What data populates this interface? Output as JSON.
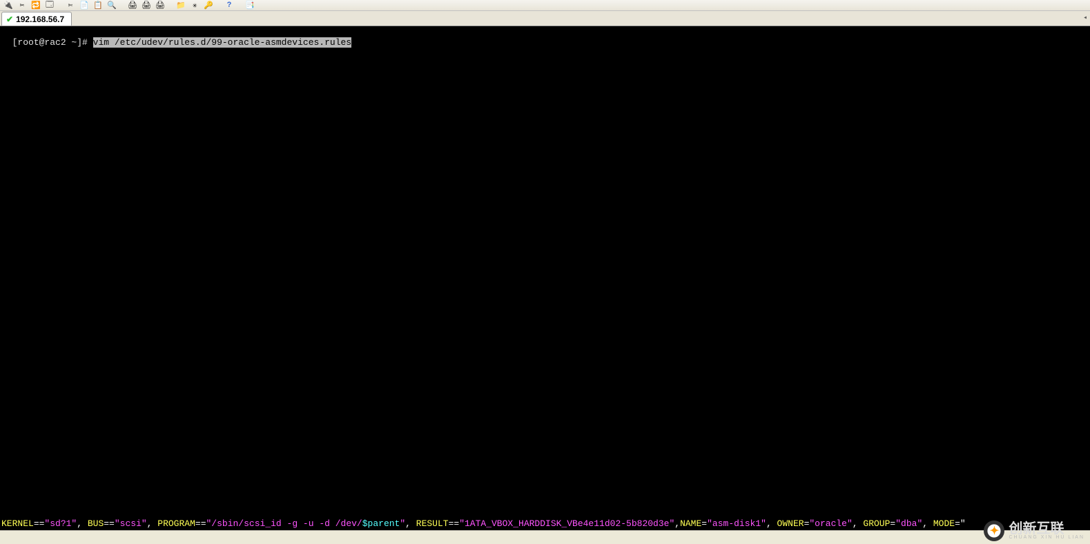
{
  "toolbar": {
    "icons": [
      "connect",
      "disconnect",
      "reconnect",
      "new-window",
      "cut",
      "copy",
      "paste",
      "find",
      "print",
      "print-preview",
      "page-setup",
      "properties",
      "settings",
      "highlight",
      "help",
      "toggle"
    ]
  },
  "tab": {
    "host": "192.168.56.7",
    "status_icon": "check"
  },
  "terminal": {
    "prompt": "[root@rac2 ~]# ",
    "command_selected": "vim /etc/udev/rules.d/99-oracle-asmdevices.rules",
    "vim_rule": {
      "kernel_key": "KERNEL",
      "eqeq": "==",
      "eq": "=",
      "comma": ", ",
      "comma_ns": ",",
      "kernel_val": "\"sd?1\"",
      "bus_key": "BUS",
      "bus_val": "\"scsi\"",
      "program_key": "PROGRAM",
      "program_val_pre": "\"/sbin/scsi_id -g -u -d /dev/",
      "program_val_var": "$parent",
      "program_val_post": "\"",
      "result_key": "RESULT",
      "result_val": "\"1ATA_VBOX_HARDDISK_VBe4e11d02-5b820d3e\"",
      "name_key": "NAME",
      "name_val": "\"asm-disk1\"",
      "owner_key": "OWNER",
      "owner_val": "\"oracle\"",
      "group_key": "GROUP",
      "group_val": "\"dba\"",
      "mode_key": "MODE",
      "mode_trail": "=\""
    }
  },
  "watermark": {
    "main": "创新互联",
    "sub": "CHUANG XIN HU LIAN",
    "logo_glyph": "✦"
  }
}
